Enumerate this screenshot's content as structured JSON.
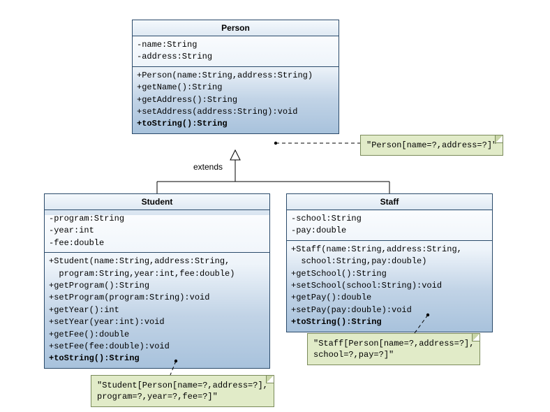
{
  "extendsLabel": "extends",
  "person": {
    "title": "Person",
    "attrs": [
      "-name:String",
      "-address:String"
    ],
    "ops": [
      "+Person(name:String,address:String)",
      "+getName():String",
      "+getAddress():String",
      "+setAddress(address:String):void"
    ],
    "toString": "+toString():String",
    "note": "\"Person[name=?,address=?]\""
  },
  "student": {
    "title": "Student",
    "attrs": [
      "-program:String",
      "-year:int",
      "-fee:double"
    ],
    "ops": [
      "+Student(name:String,address:String,",
      "  program:String,year:int,fee:double)",
      "+getProgram():String",
      "+setProgram(program:String):void",
      "+getYear():int",
      "+setYear(year:int):void",
      "+getFee():double",
      "+setFee(fee:double):void"
    ],
    "toString": "+toString():String",
    "noteL1": "\"Student[Person[name=?,address=?],",
    "noteL2": "program=?,year=?,fee=?]\""
  },
  "staff": {
    "title": "Staff",
    "attrs": [
      "-school:String",
      "-pay:double"
    ],
    "ops": [
      "+Staff(name:String,address:String,",
      "  school:String,pay:double)",
      "+getSchool():String",
      "+setSchool(school:String):void",
      "+getPay():double",
      "+setPay(pay:double):void"
    ],
    "toString": "+toString():String",
    "noteL1": "\"Staff[Person[name=?,address=?],",
    "noteL2": "school=?,pay=?]\""
  }
}
